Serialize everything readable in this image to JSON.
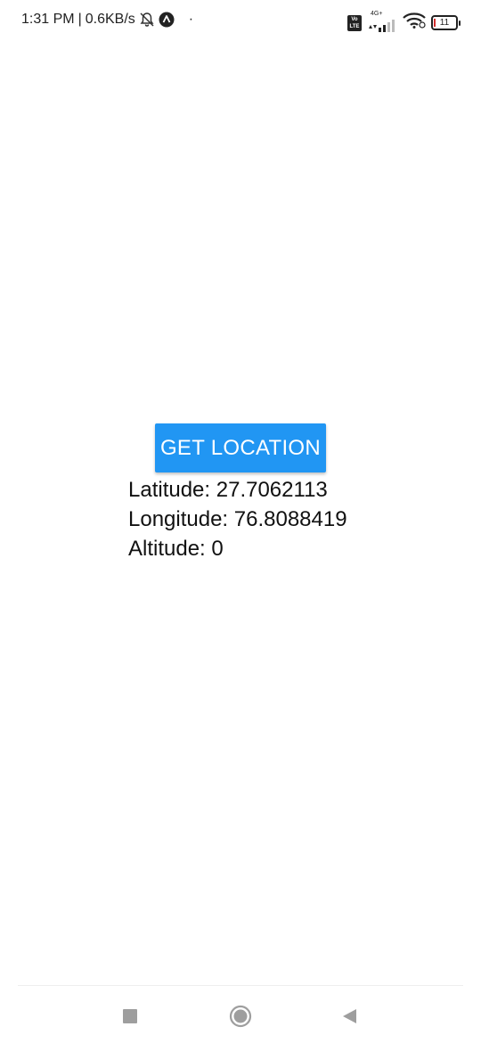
{
  "status_bar": {
    "time": "1:31 PM",
    "separator": "|",
    "network_speed": "0.6KB/s",
    "dot": "·",
    "volte_top": "Vo",
    "volte_bottom": "LTE",
    "network_type": "4G+",
    "battery_level": "11",
    "icons": [
      "mute-icon",
      "app-notification-icon",
      "signal-icon",
      "wifi-icon",
      "battery-icon"
    ]
  },
  "main": {
    "button_label": "GET LOCATION",
    "latitude": "Latitude: 27.7062113",
    "longitude": "Longitude: 76.8088419",
    "altitude": "Altitude: 0"
  },
  "nav_bar": {
    "icons": [
      "recents-icon",
      "home-icon",
      "back-icon"
    ]
  },
  "colors": {
    "button_bg": "#2196F3",
    "button_text": "#ffffff",
    "text": "#111111",
    "background": "#ffffff",
    "nav_icon": "#9e9e9e"
  }
}
